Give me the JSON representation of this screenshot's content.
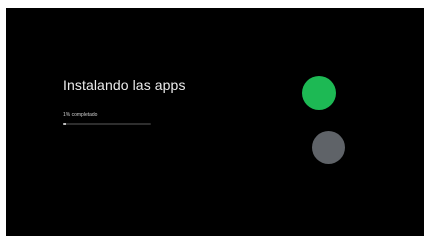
{
  "screen": {
    "title": "Instalando las apps",
    "progress_label": "1% completado",
    "progress_value": 0.01
  },
  "colors": {
    "background": "#000000",
    "accent_green": "#1db954",
    "accent_gray": "#5f6368"
  },
  "decorations": [
    {
      "name": "green-circle"
    },
    {
      "name": "gray-circle"
    }
  ]
}
